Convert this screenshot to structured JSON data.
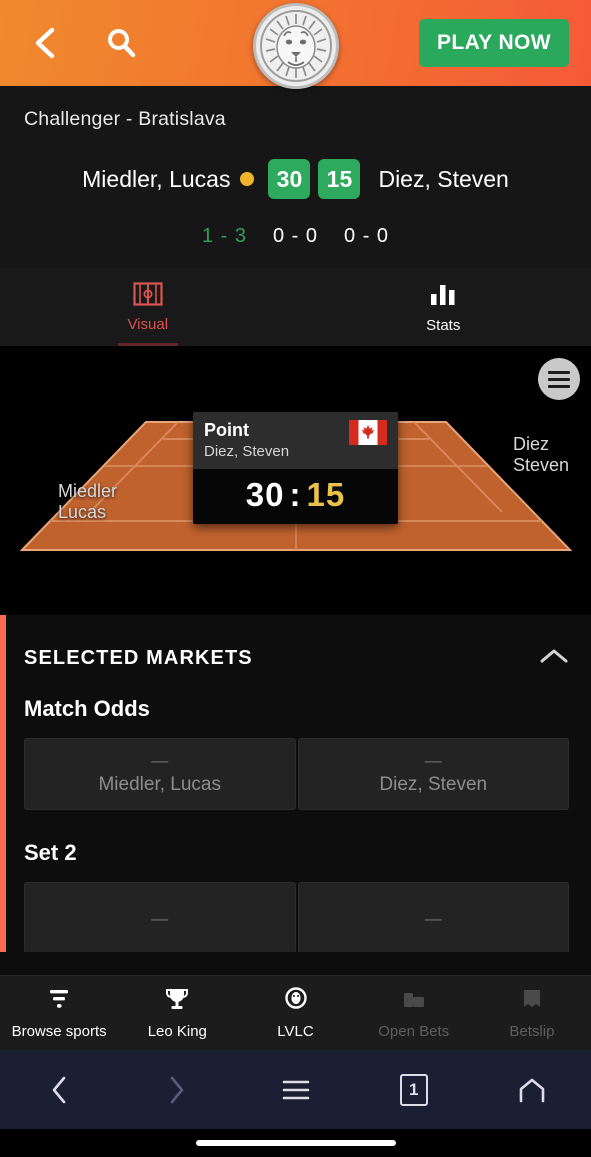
{
  "header": {
    "back_icon": "chevron-left-icon",
    "search_icon": "search-icon",
    "logo_icon": "lion-logo-icon",
    "play_now_label": "PLAY NOW",
    "bg_start_color": "#f08a2e",
    "bg_end_color": "#f55a38",
    "play_now_color": "#2aa85c"
  },
  "match": {
    "league": "Challenger - Bratislava",
    "home_player": "Miedler, Lucas",
    "away_player": "Diez, Steven",
    "home_game_score": "30",
    "away_game_score": "15",
    "serving": "home",
    "serve_dot_color": "#f0b429",
    "score_box_color": "#2eaa5e",
    "sets": [
      {
        "value": "1 - 3",
        "completed": true
      },
      {
        "value": "0 - 0",
        "completed": false
      },
      {
        "value": "0 - 0",
        "completed": false
      }
    ],
    "completed_set_color": "#2e9e5b"
  },
  "tabs": [
    {
      "label": "Visual",
      "icon": "court-icon",
      "active": true,
      "color": "#d9534f"
    },
    {
      "label": "Stats",
      "icon": "bar-chart-icon",
      "active": false,
      "color": "#ffffff"
    }
  ],
  "court": {
    "menu_icon": "hamburger-menu-icon",
    "surface_color": "#c0622e",
    "home_label_line1": "Miedler",
    "home_label_line2": "Lucas",
    "away_label_line1": "Diez",
    "away_label_line2": "Steven",
    "overlay": {
      "title": "Point",
      "subtitle": "Diez, Steven",
      "flag_icon": "canada-flag-icon",
      "home_score": "30",
      "separator": ":",
      "away_score": "15",
      "away_score_color": "#e8c24a"
    }
  },
  "markets": {
    "accent_color": "#ff6b52",
    "section_title": "SELECTED MARKETS",
    "collapse_icon": "chevron-up-icon",
    "groups": [
      {
        "title": "Match Odds",
        "selections": [
          {
            "odds": "—",
            "label": "Miedler, Lucas"
          },
          {
            "odds": "—",
            "label": "Diez, Steven"
          }
        ]
      },
      {
        "title": "Set 2",
        "selections": [
          {
            "odds": "—",
            "label": ""
          },
          {
            "odds": "—",
            "label": ""
          }
        ]
      }
    ]
  },
  "app_nav": [
    {
      "label": "Browse sports",
      "icon": "filter-icon",
      "dim": false
    },
    {
      "label": "Leo King",
      "icon": "trophy-icon",
      "dim": false
    },
    {
      "label": "LVLC",
      "icon": "lion-badge-icon",
      "dim": false
    },
    {
      "label": "Open Bets",
      "icon": "bets-icon",
      "dim": true
    },
    {
      "label": "Betslip",
      "icon": "betslip-icon",
      "dim": true
    }
  ],
  "system_nav": {
    "back_icon": "chevron-left-icon",
    "forward_icon": "chevron-right-icon",
    "menu_icon": "hamburger-menu-icon",
    "tab_count": "1",
    "home_icon": "home-icon",
    "bar_color": "#1b1f33"
  }
}
